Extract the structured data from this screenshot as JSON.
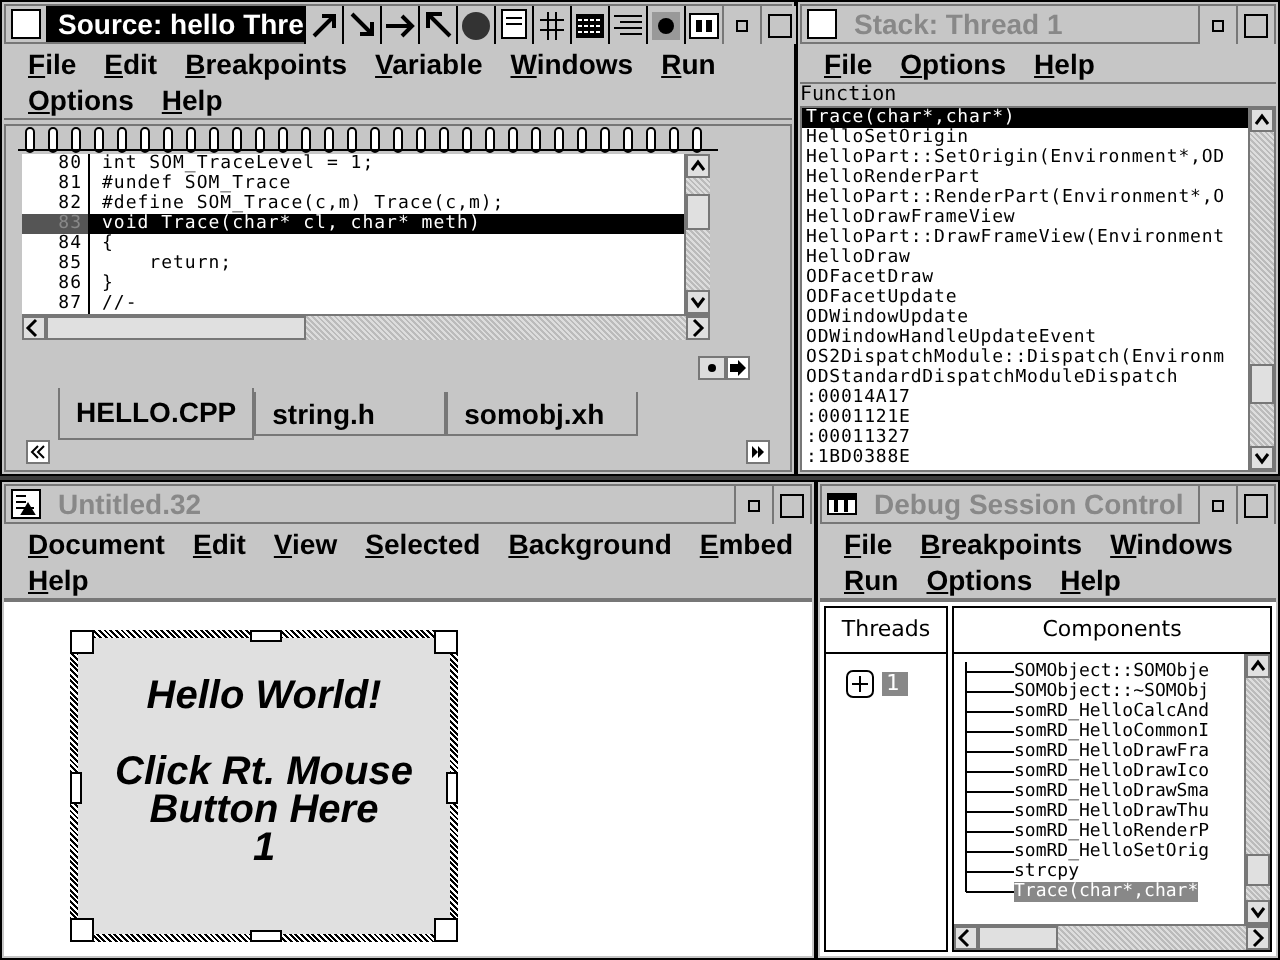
{
  "source_window": {
    "title": "Source: hello Thre",
    "active": true,
    "menu_rows": [
      [
        "File",
        "Edit",
        "Breakpoints",
        "Variable",
        "Windows",
        "Run"
      ],
      [
        "Options",
        "Help"
      ]
    ],
    "lines": [
      {
        "number": "80",
        "code": "int SOM_TraceLevel = 1;",
        "selected": false
      },
      {
        "number": "81",
        "code": "#undef SOM_Trace",
        "selected": false
      },
      {
        "number": "82",
        "code": "#define SOM_Trace(c,m) Trace(c,m);",
        "selected": false
      },
      {
        "number": "83",
        "code": "void Trace(char* cl, char* meth)",
        "selected": true
      },
      {
        "number": "84",
        "code": "{",
        "selected": false
      },
      {
        "number": "85",
        "code": "    return;",
        "selected": false
      },
      {
        "number": "86",
        "code": "}",
        "selected": false
      },
      {
        "number": "87",
        "code": "//-",
        "selected": false
      }
    ],
    "tabs": [
      {
        "label": "HELLO.CPP",
        "selected": true
      },
      {
        "label": "string.h",
        "selected": false
      },
      {
        "label": "somobj.xh",
        "selected": false
      }
    ]
  },
  "stack_window": {
    "title": "Stack:  Thread 1",
    "active": false,
    "menu_rows": [
      [
        "File",
        "Options",
        "Help"
      ]
    ],
    "header": "Function",
    "frames": [
      {
        "label": "Trace(char*,char*)",
        "selected": true
      },
      {
        "label": "HelloSetOrigin",
        "selected": false
      },
      {
        "label": "HelloPart::SetOrigin(Environment*,OD",
        "selected": false
      },
      {
        "label": "HelloRenderPart",
        "selected": false
      },
      {
        "label": "HelloPart::RenderPart(Environment*,O",
        "selected": false
      },
      {
        "label": "HelloDrawFrameView",
        "selected": false
      },
      {
        "label": "HelloPart::DrawFrameView(Environment",
        "selected": false
      },
      {
        "label": "HelloDraw",
        "selected": false
      },
      {
        "label": "ODFacetDraw",
        "selected": false
      },
      {
        "label": "ODFacetUpdate",
        "selected": false
      },
      {
        "label": "ODWindowUpdate",
        "selected": false
      },
      {
        "label": "ODWindowHandleUpdateEvent",
        "selected": false
      },
      {
        "label": "OS2DispatchModule::Dispatch(Environm",
        "selected": false
      },
      {
        "label": "ODStandardDispatchModuleDispatch",
        "selected": false
      },
      {
        "label": ":00014A17",
        "selected": false
      },
      {
        "label": ":0001121E",
        "selected": false
      },
      {
        "label": ":00011327",
        "selected": false
      },
      {
        "label": ":1BD0388E",
        "selected": false
      }
    ]
  },
  "document_window": {
    "title": "Untitled.32",
    "active": false,
    "menu_rows": [
      [
        "Document",
        "Edit",
        "View",
        "Selected",
        "Background",
        "Embed"
      ],
      [
        "Help"
      ]
    ],
    "part_text": [
      "Hello World!",
      "Click Rt. Mouse",
      "Button Here",
      "1"
    ]
  },
  "session_window": {
    "title": "Debug Session Control",
    "active": false,
    "menu_rows": [
      [
        "File",
        "Breakpoints",
        "Windows"
      ],
      [
        "Run",
        "Options",
        "Help"
      ]
    ],
    "threads_header": "Threads",
    "components_header": "Components",
    "threads": [
      {
        "label": "1",
        "expanded": false,
        "selected": true
      }
    ],
    "components": [
      {
        "label": "SOMObject::SOMObje",
        "selected": false
      },
      {
        "label": "SOMObject::~SOMObj",
        "selected": false
      },
      {
        "label": "somRD_HelloCalcAnd",
        "selected": false
      },
      {
        "label": "somRD_HelloCommonI",
        "selected": false
      },
      {
        "label": "somRD_HelloDrawFra",
        "selected": false
      },
      {
        "label": "somRD_HelloDrawIco",
        "selected": false
      },
      {
        "label": "somRD_HelloDrawSma",
        "selected": false
      },
      {
        "label": "somRD_HelloDrawThu",
        "selected": false
      },
      {
        "label": "somRD_HelloRenderP",
        "selected": false
      },
      {
        "label": "somRD_HelloSetOrig",
        "selected": false
      },
      {
        "label": "strcpy",
        "selected": false
      },
      {
        "label": "Trace(char*,char*",
        "selected": true
      }
    ]
  }
}
